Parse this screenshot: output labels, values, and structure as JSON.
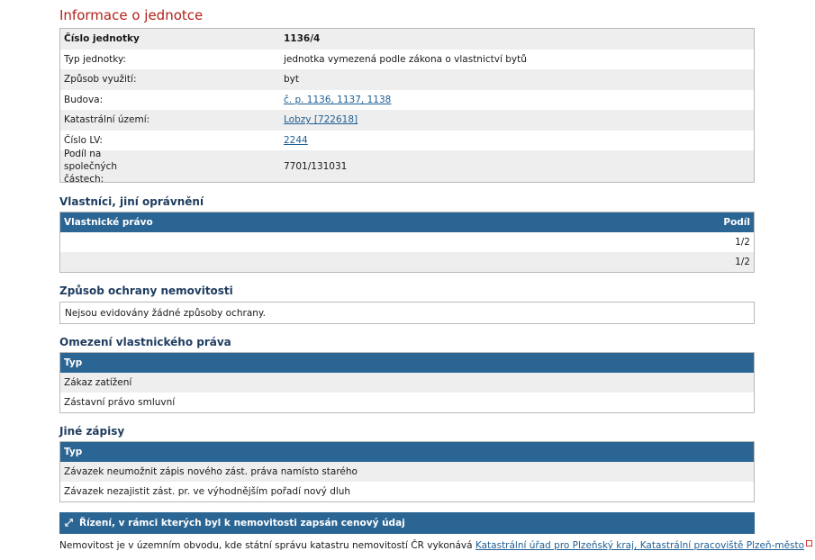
{
  "title": "Informace o jednotce",
  "info": {
    "rows": [
      {
        "label": "Číslo jednotky",
        "value": "1136/4"
      },
      {
        "label": "Typ jednotky:",
        "value": "jednotka vymezená podle zákona o vlastnictví bytů"
      },
      {
        "label": "Způsob využití:",
        "value": "byt"
      },
      {
        "label": "Budova:",
        "value": "č. p. 1136, 1137, 1138"
      },
      {
        "label": "Katastrální území:",
        "value": "Lobzy [722618]"
      },
      {
        "label": "Číslo LV:",
        "value": "2244"
      },
      {
        "label": "Podíl na společných částech:",
        "value": "7701/131031"
      }
    ]
  },
  "owners": {
    "title": "Vlastníci, jiní oprávnění",
    "col_right": "Vlastnické právo",
    "col_share": "Podíl",
    "rows": [
      {
        "name": "",
        "share": "1/2"
      },
      {
        "name": "",
        "share": "1/2"
      }
    ]
  },
  "protection": {
    "title": "Způsob ochrany nemovitosti",
    "text": "Nejsou evidovány žádné způsoby ochrany."
  },
  "restrictions": {
    "title": "Omezení vlastnického práva",
    "col_type": "Typ",
    "rows": [
      "Zákaz zatížení",
      "Zástavní právo smluvní"
    ]
  },
  "other": {
    "title": "Jiné zápisy",
    "col_type": "Typ",
    "rows": [
      "Závazek neumožnit zápis nového zást. práva namísto starého",
      "Závazek nezajistit zást. pr. ve výhodnějším pořadí nový dluh"
    ]
  },
  "proceedings": {
    "icon": "expand-arrows-icon",
    "label": "Řízení, v rámci kterých byl k nemovitosti zapsán cenový údaj"
  },
  "footer": {
    "text": "Nemovitost je v územním obvodu, kde státní správu katastru nemovitostí ČR vykonává",
    "link": "Katastrální úřad pro Plzeňský kraj, Katastrální pracoviště Plzeň-město"
  }
}
